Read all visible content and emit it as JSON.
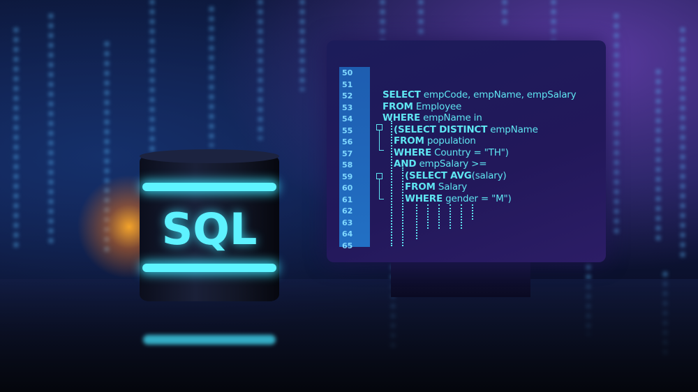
{
  "database": {
    "label": "SQL"
  },
  "editor": {
    "line_numbers": [
      "50",
      "51",
      "52",
      "53",
      "54",
      "55",
      "56",
      "57",
      "58",
      "59",
      "60",
      "61",
      "62",
      "63",
      "64",
      "65"
    ],
    "code_lines": [
      {
        "kw": "SELECT",
        "rest": " empCode, empName, empSalary",
        "indent": 0,
        "line": 2
      },
      {
        "kw": "FROM",
        "rest": " Employee",
        "indent": 0,
        "line": 3
      },
      {
        "kw": "WHERE",
        "rest": " empName in",
        "indent": 0,
        "line": 4
      },
      {
        "kw": "(SELECT DISTINCT",
        "rest": " empName",
        "indent": 1,
        "line": 5
      },
      {
        "kw": "FROM",
        "rest": " population",
        "indent": 1,
        "line": 6
      },
      {
        "kw": "WHERE",
        "rest": " Country = \"TH\")",
        "indent": 1,
        "line": 7
      },
      {
        "kw": "AND",
        "rest": " empSalary >=",
        "indent": 1,
        "line": 8
      },
      {
        "kw": "(SELECT AVG",
        "rest": "(salary)",
        "indent": 2,
        "line": 9
      },
      {
        "kw": "FROM",
        "rest": " Salary",
        "indent": 2,
        "line": 10
      },
      {
        "kw": "WHERE",
        "rest": " gender = \"M\")",
        "indent": 2,
        "line": 11
      }
    ]
  },
  "colors": {
    "code": "#5fe6f2",
    "glow": "#5ef4ff",
    "accent_orange": "#ffaa28"
  }
}
